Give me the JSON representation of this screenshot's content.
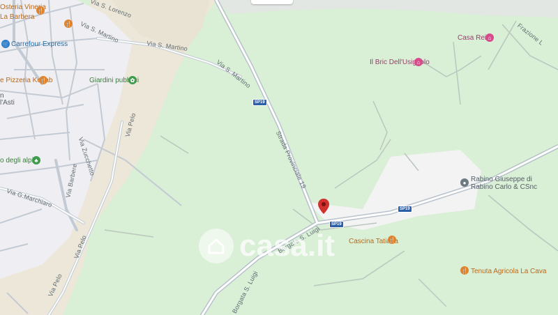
{
  "map": {
    "watermark": "casa.it",
    "road_shields": [
      "SP19",
      "SP19",
      "SP19"
    ],
    "streets": {
      "s_lorenzo": "Via S. Lorenzo",
      "s_martino_1": "Via S. Martino",
      "s_martino_2": "Via S. Martino",
      "s_martino_3": "Via S. Martino",
      "sp19": "Strada Provinciale 19",
      "pelo_1": "Via Pelo",
      "pelo_2": "Via Pelo",
      "pelo_3": "Via Pelo",
      "zucchetto": "Via Zucchetto",
      "barbere": "Via Barbere",
      "marchiaro": "Via G.Marchiaro",
      "borgata_1": "Borgata S. Luigi",
      "borgata_2": "Borgata S. Luigi",
      "frazione": "Frazione L"
    },
    "pois": {
      "osteria": "Osteria Vineria",
      "barbera": "La Barbera",
      "carrefour": "Carrefour Express",
      "pizzeria": "e Pizzeria Kebab",
      "giardini": "Giardini pubblici",
      "casa_reis": "Casa Reis",
      "bric": "Il Bric Dell'Usignolo",
      "alpini": "o degli alpini",
      "rabino1": "Rabino Giuseppe di",
      "rabino2": "Rabino Carlo & CSnc",
      "cascina": "Cascina Tatiana",
      "tenuta": "Tenuta Agricola La Cava",
      "frag_n": "n",
      "frag_asti": "l'Asti"
    },
    "icons": {
      "marker": "location-pin-icon",
      "restaurant": "restaurant-icon",
      "shop": "shopping-cart-icon",
      "park": "park-icon",
      "hotel": "hotel-icon",
      "business": "business-icon"
    },
    "colors": {
      "green_area": "#d9efd6",
      "town": "#eeeef1",
      "farmland": "#ede8da",
      "road": "#b7c1cc",
      "marker": "#d0312d"
    }
  }
}
